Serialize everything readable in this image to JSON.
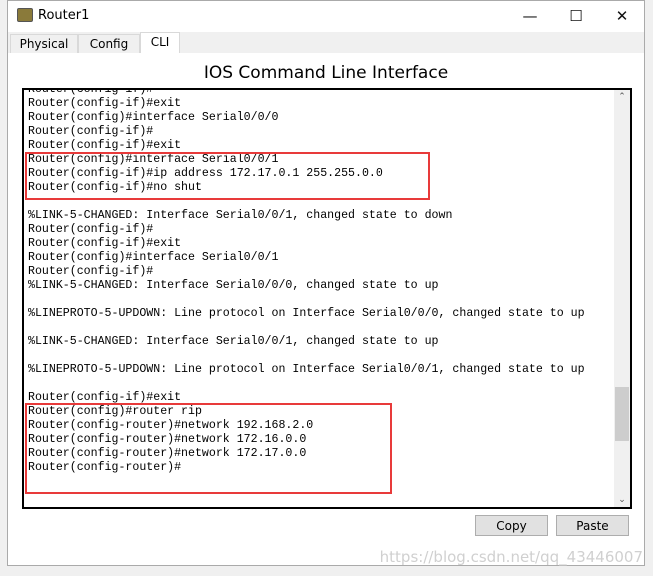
{
  "window": {
    "title": "Router1",
    "icon": "router-icon"
  },
  "tabs": [
    {
      "label": "Physical"
    },
    {
      "label": "Config"
    },
    {
      "label": "CLI",
      "active": true
    }
  ],
  "heading": "IOS Command Line Interface",
  "terminal": {
    "lines": [
      "Router(config-if)#",
      "Router(config-if)#exit",
      "Router(config)#interface Serial0/0/0",
      "Router(config-if)#",
      "Router(config-if)#exit",
      "Router(config)#interface Serial0/0/1",
      "Router(config-if)#ip address 172.17.0.1 255.255.0.0",
      "Router(config-if)#no shut",
      "",
      "%LINK-5-CHANGED: Interface Serial0/0/1, changed state to down",
      "Router(config-if)#",
      "Router(config-if)#exit",
      "Router(config)#interface Serial0/0/1",
      "Router(config-if)#",
      "%LINK-5-CHANGED: Interface Serial0/0/0, changed state to up",
      "",
      "%LINEPROTO-5-UPDOWN: Line protocol on Interface Serial0/0/0, changed state to up",
      "",
      "%LINK-5-CHANGED: Interface Serial0/0/1, changed state to up",
      "",
      "%LINEPROTO-5-UPDOWN: Line protocol on Interface Serial0/0/1, changed state to up",
      "",
      "Router(config-if)#exit",
      "Router(config)#router rip",
      "Router(config-router)#network 192.168.2.0",
      "Router(config-router)#network 172.16.0.0",
      "Router(config-router)#network 172.17.0.0",
      "Router(config-router)#"
    ]
  },
  "highlight_color": "#e83a3a",
  "buttons": {
    "copy": "Copy",
    "paste": "Paste"
  },
  "watermark": "https://blog.csdn.net/qq_43446007"
}
